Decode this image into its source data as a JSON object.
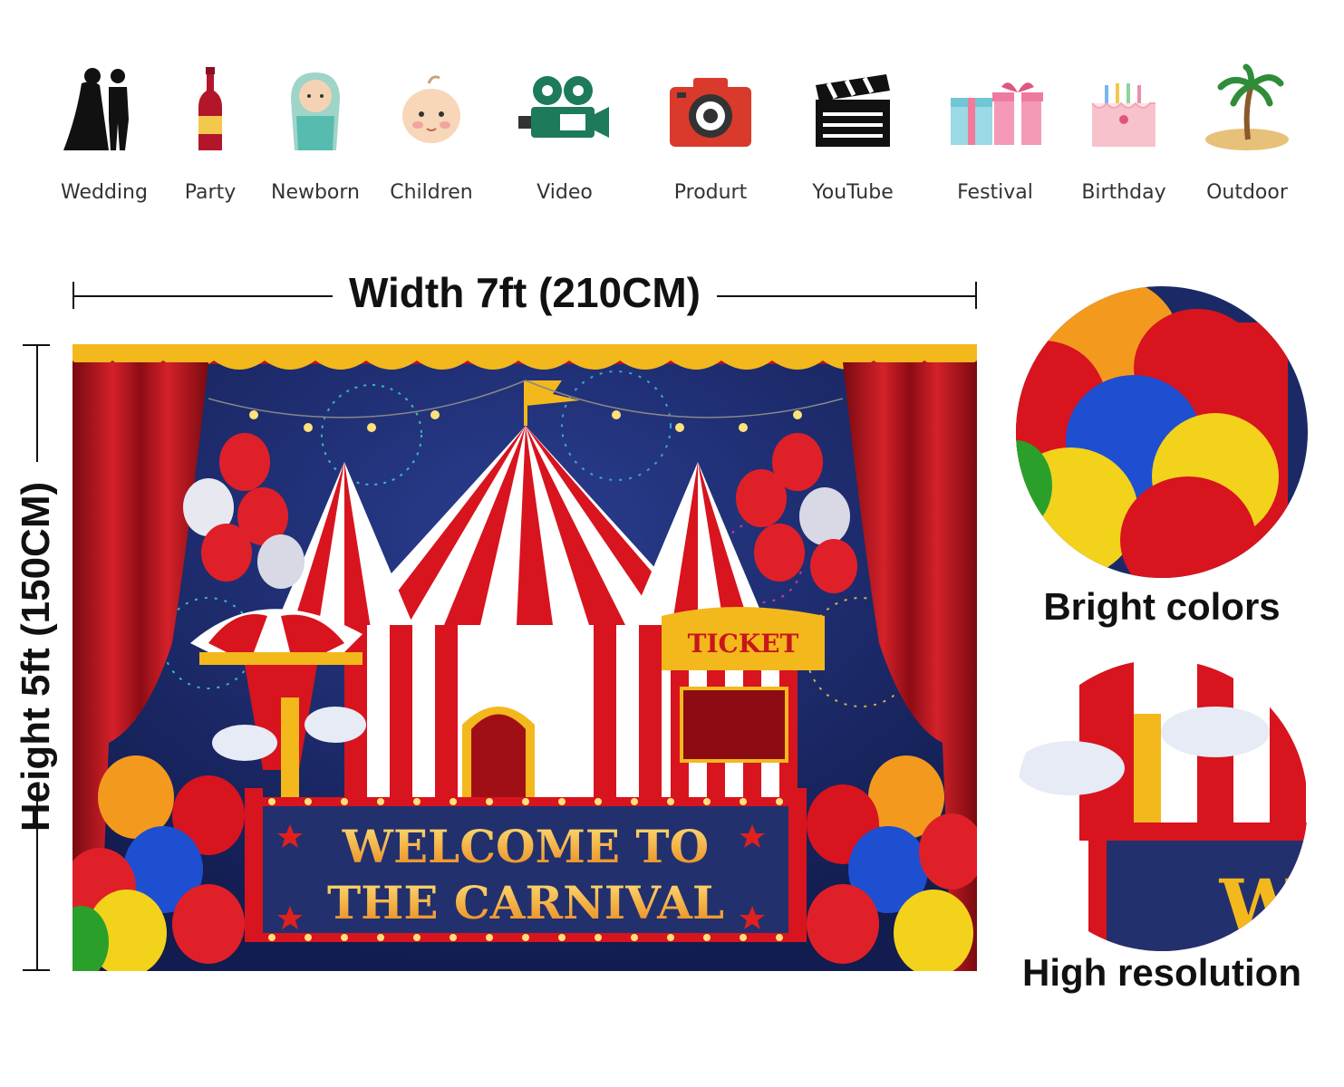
{
  "uses": [
    {
      "label": "Wedding",
      "icon": "wedding-couple-icon"
    },
    {
      "label": "Party",
      "icon": "wine-bottle-icon"
    },
    {
      "label": "Newborn",
      "icon": "newborn-baby-icon"
    },
    {
      "label": "Children",
      "icon": "child-face-icon"
    },
    {
      "label": "Video",
      "icon": "video-camera-icon"
    },
    {
      "label": "Produrt",
      "icon": "camera-icon"
    },
    {
      "label": "YouTube",
      "icon": "clapperboard-icon"
    },
    {
      "label": "Festival",
      "icon": "gift-boxes-icon"
    },
    {
      "label": "Birthday",
      "icon": "birthday-cake-icon"
    },
    {
      "label": "Outdoor",
      "icon": "palm-island-icon"
    }
  ],
  "dimensions": {
    "width_label": "Width 7ft (210CM)",
    "height_label": "Height 5ft (150CM)"
  },
  "backdrop": {
    "line1": "WELCOME TO",
    "line2": "THE CARNIVAL",
    "ticket": "TICKET"
  },
  "features": {
    "colors_label": "Bright colors",
    "resolution_label": "High resolution",
    "zoom_text": "WE"
  },
  "colors": {
    "curtain_red": "#c8161d",
    "night_blue": "#1b2a66",
    "gold": "#f3b81c",
    "sign_navy": "#23306e"
  }
}
